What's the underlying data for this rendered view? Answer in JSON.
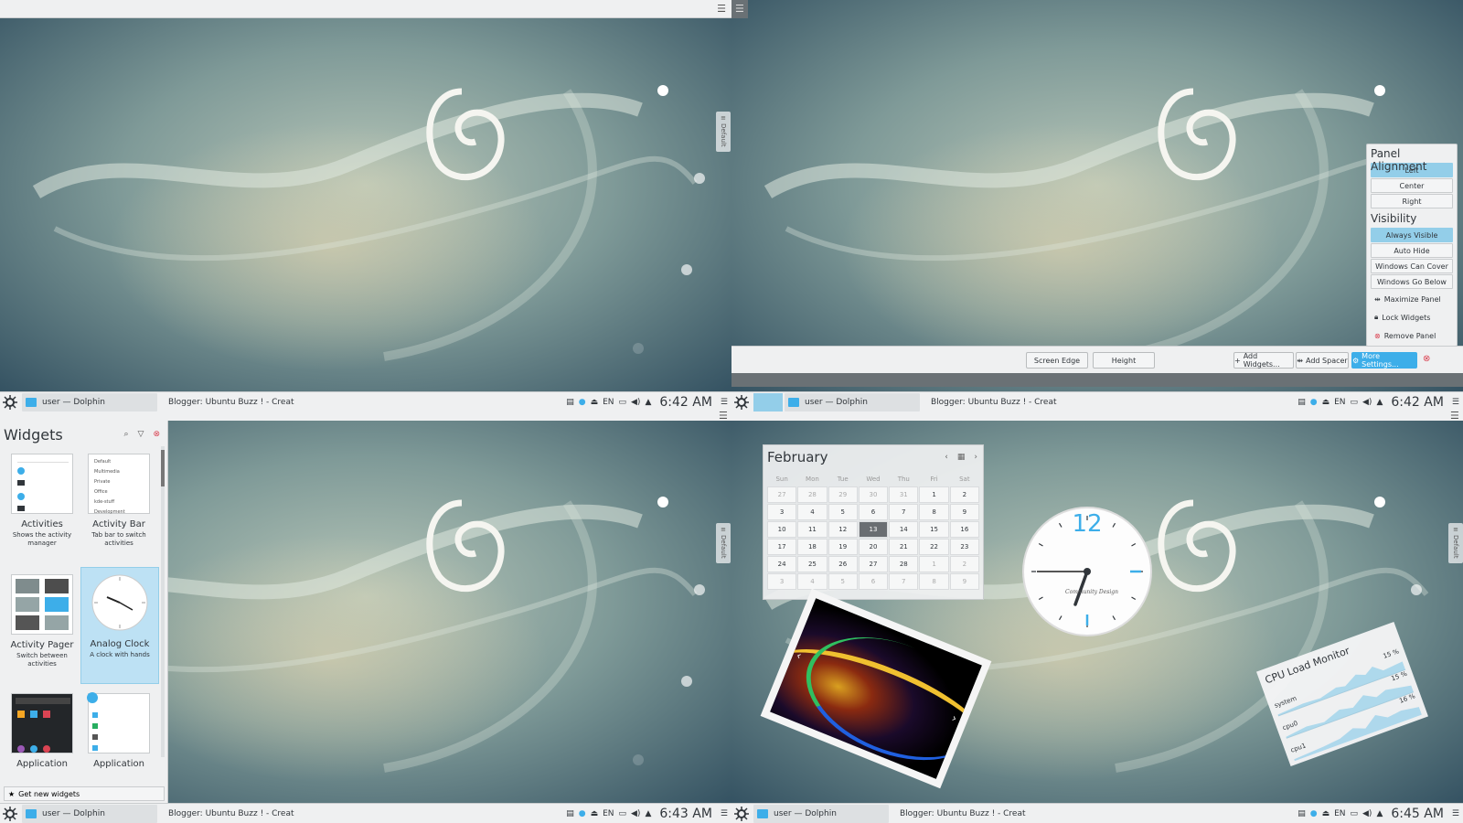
{
  "taskbar": {
    "tasks": [
      {
        "label": "user — Dolphin"
      },
      {
        "label": "Blogger: Ubuntu Buzz ! - Create po..."
      }
    ],
    "tray_lang": "EN"
  },
  "desktop_tab": {
    "label": "Default"
  },
  "q1": {
    "clock": "6:42 AM"
  },
  "q2": {
    "clock": "6:42 AM",
    "flyout": {
      "alignment_heading": "Panel Alignment",
      "alignment_options": [
        "Left",
        "Center",
        "Right"
      ],
      "alignment_selected": "Left",
      "visibility_heading": "Visibility",
      "visibility_options": [
        "Always Visible",
        "Auto Hide",
        "Windows Can Cover",
        "Windows Go Below"
      ],
      "visibility_selected": "Always Visible",
      "actions": [
        "Maximize Panel",
        "Lock Widgets",
        "Remove Panel"
      ]
    },
    "config_toolbar": {
      "screen_edge": "Screen Edge",
      "height": "Height",
      "add_widgets": "Add Widgets...",
      "add_spacer": "Add Spacer",
      "more_settings": "More Settings..."
    }
  },
  "q3": {
    "clock": "6:43 AM",
    "widgets": {
      "title": "Widgets",
      "get_new": "Get new widgets",
      "cards": [
        {
          "name": "Activities",
          "desc": "Shows the activity manager"
        },
        {
          "name": "Activity Bar",
          "desc": "Tab bar to switch activities"
        },
        {
          "name": "Activity Pager",
          "desc": "Switch between activities"
        },
        {
          "name": "Analog Clock",
          "desc": "A clock with hands"
        },
        {
          "name": "Application",
          "desc": ""
        },
        {
          "name": "Application",
          "desc": ""
        }
      ],
      "activity_bar_items": [
        "Default",
        "Multimedia",
        "Private",
        "Office",
        "kde-stuff",
        "Development"
      ]
    }
  },
  "q4": {
    "clock": "6:45 AM",
    "calendar": {
      "month": "February",
      "weekdays": [
        "Sun",
        "Mon",
        "Tue",
        "Wed",
        "Thu",
        "Fri",
        "Sat"
      ],
      "weeks": [
        [
          "27",
          "28",
          "29",
          "30",
          "31",
          "1",
          "2"
        ],
        [
          "3",
          "4",
          "5",
          "6",
          "7",
          "8",
          "9"
        ],
        [
          "10",
          "11",
          "12",
          "13",
          "14",
          "15",
          "16"
        ],
        [
          "17",
          "18",
          "19",
          "20",
          "21",
          "22",
          "23"
        ],
        [
          "24",
          "25",
          "26",
          "27",
          "28",
          "1",
          "2"
        ],
        [
          "3",
          "4",
          "5",
          "6",
          "7",
          "8",
          "9"
        ]
      ],
      "today": "13"
    },
    "analog_clock": {
      "twelve": "12",
      "caption": "Community Design"
    },
    "cpu_monitor": {
      "title": "CPU Load Monitor",
      "rows": [
        {
          "label": "system",
          "value": "15 %"
        },
        {
          "label": "cpu0",
          "value": "15 %"
        },
        {
          "label": "cpu1",
          "value": "16 %"
        }
      ]
    }
  },
  "colors": {
    "accent": "#3daee9",
    "panel_bg": "#eff0f1",
    "text": "#31363b"
  }
}
